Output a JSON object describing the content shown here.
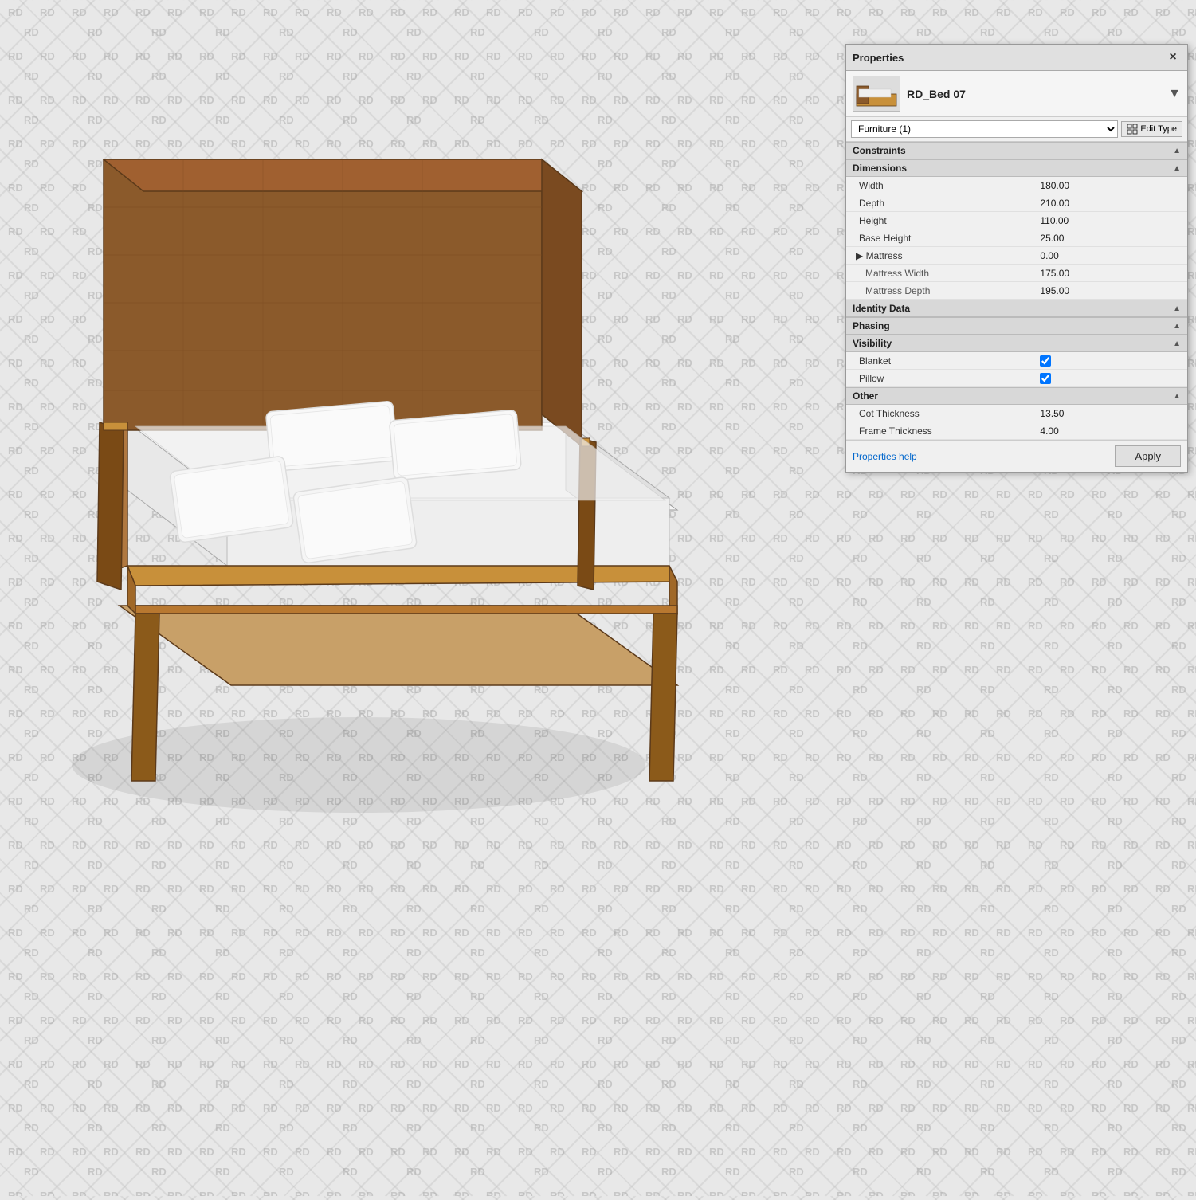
{
  "panel": {
    "title": "Properties",
    "close_label": "×",
    "object_thumbnail_alt": "bed-thumbnail",
    "object_name": "RD_Bed 07",
    "type_selector_value": "Furniture (1)",
    "edit_type_label": "Edit Type",
    "sections": {
      "constraints": "Constraints",
      "dimensions": "Dimensions",
      "identity_data": "Identity Data",
      "phasing": "Phasing",
      "visibility": "Visibility",
      "other": "Other"
    },
    "properties": {
      "width_label": "Width",
      "width_value": "180.00",
      "depth_label": "Depth",
      "depth_value": "210.00",
      "height_label": "Height",
      "height_value": "110.00",
      "base_height_label": "Base Height",
      "base_height_value": "25.00",
      "mattress_label": "▶ Mattress",
      "mattress_value": "0.00",
      "mattress_width_label": "Mattress Width",
      "mattress_width_value": "175.00",
      "mattress_depth_label": "Mattress Depth",
      "mattress_depth_value": "195.00",
      "blanket_label": "Blanket",
      "pillow_label": "Pillow",
      "cot_thickness_label": "Cot Thickness",
      "cot_thickness_value": "13.50",
      "frame_thickness_label": "Frame Thickness",
      "frame_thickness_value": "4.00"
    },
    "help_link": "Properties help",
    "apply_button": "Apply"
  },
  "watermark": {
    "text": "RD"
  }
}
